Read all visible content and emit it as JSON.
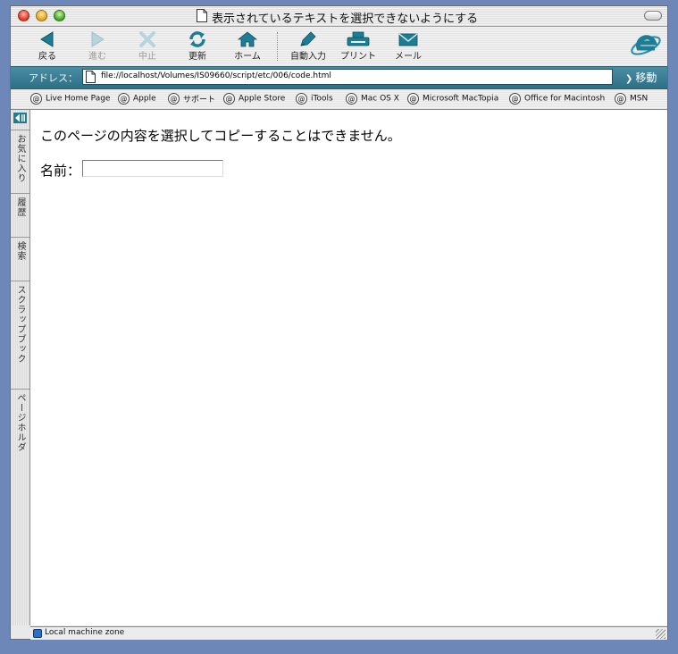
{
  "window": {
    "title": "表示されているテキストを選択できないようにする"
  },
  "toolbar": {
    "buttons": [
      {
        "label": "戻る",
        "icon": "back-arrow-icon",
        "enabled": true
      },
      {
        "label": "進む",
        "icon": "forward-arrow-icon",
        "enabled": false
      },
      {
        "label": "中止",
        "icon": "stop-x-icon",
        "enabled": false
      },
      {
        "label": "更新",
        "icon": "refresh-icon",
        "enabled": true
      },
      {
        "label": "ホーム",
        "icon": "home-icon",
        "enabled": true
      },
      {
        "label": "自動入力",
        "icon": "autofill-pen-icon",
        "enabled": true
      },
      {
        "label": "プリント",
        "icon": "printer-icon",
        "enabled": true
      },
      {
        "label": "メール",
        "icon": "mail-envelope-icon",
        "enabled": true
      }
    ]
  },
  "address": {
    "label": "アドレス：",
    "url": "file://localhost/Volumes/IS09660/script/etc/006/code.html",
    "go_label": "移動"
  },
  "favorites": [
    {
      "label": "Live Home Page"
    },
    {
      "label": "Apple"
    },
    {
      "label": "サポート"
    },
    {
      "label": "Apple Store"
    },
    {
      "label": "iTools"
    },
    {
      "label": "Mac OS X"
    },
    {
      "label": "Microsoft MacTopia"
    },
    {
      "label": "Office for Macintosh"
    },
    {
      "label": "MSN"
    }
  ],
  "sidebar": {
    "tabs": [
      {
        "label": "お気に入り"
      },
      {
        "label": "履歴"
      },
      {
        "label": "検索"
      },
      {
        "label": "スクラップブック"
      },
      {
        "label": "ページホルダ"
      }
    ]
  },
  "page": {
    "message": "このページの内容を選択してコピーすることはできません。",
    "name_label": "名前：",
    "name_value": ""
  },
  "status": {
    "zone": "Local machine zone"
  },
  "colors": {
    "accent": "#2e6f86",
    "icon_teal": "#1d7d95"
  }
}
